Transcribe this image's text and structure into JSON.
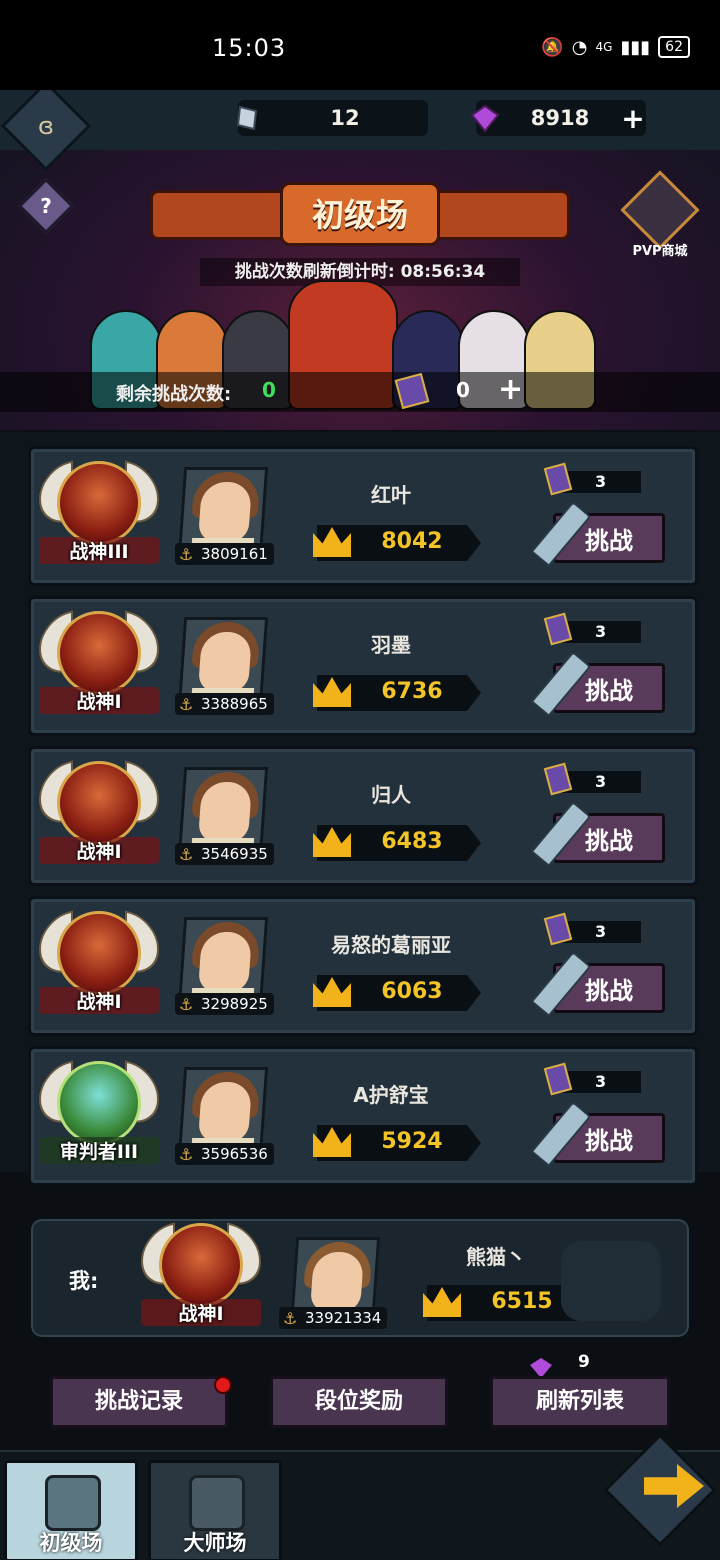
{
  "status_bar": {
    "time": "15:03",
    "signal": "4G",
    "battery": "62"
  },
  "header": {
    "resources": [
      {
        "icon": "ticket-crystal-icon",
        "value": "12"
      },
      {
        "icon": "purple-gem-icon",
        "value": "8918"
      }
    ],
    "title": "初级场",
    "pvp_shop_label": "PVP商城",
    "countdown_label": "挑战次数刷新倒计时:",
    "countdown_value": "08:56:34",
    "remaining_label": "剩余挑战次数:",
    "remaining_value": "0",
    "tickets_value": "0"
  },
  "opponents": [
    {
      "rank": "战神III",
      "uid": "3809161",
      "name": "红叶",
      "power": "8042",
      "tickets": "3",
      "action": "挑战",
      "badge": "red"
    },
    {
      "rank": "战神I",
      "uid": "3388965",
      "name": "羽墨",
      "power": "6736",
      "tickets": "3",
      "action": "挑战",
      "badge": "red"
    },
    {
      "rank": "战神I",
      "uid": "3546935",
      "name": "归人",
      "power": "6483",
      "tickets": "3",
      "action": "挑战",
      "badge": "red"
    },
    {
      "rank": "战神I",
      "uid": "3298925",
      "name": "易怒的葛丽亚",
      "power": "6063",
      "tickets": "3",
      "action": "挑战",
      "badge": "red"
    },
    {
      "rank": "审判者III",
      "uid": "3596536",
      "name": "A护舒宝",
      "power": "5924",
      "tickets": "3",
      "action": "挑战",
      "badge": "green"
    }
  ],
  "me": {
    "label": "我:",
    "rank": "战神I",
    "uid": "33921334",
    "name": "熊猫丶",
    "power": "6515"
  },
  "actions": {
    "records": "挑战记录",
    "rewards": "段位奖励",
    "refresh": "刷新列表",
    "refresh_cost": "9"
  },
  "tabs": {
    "beginner": "初级场",
    "master": "大师场"
  },
  "colors": {
    "power": "#f3c427",
    "remaining": "#3ee05a",
    "button": "#4a3550"
  }
}
